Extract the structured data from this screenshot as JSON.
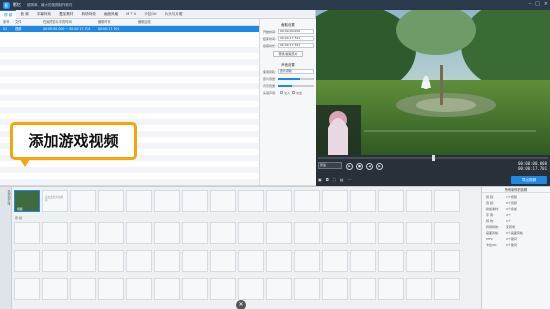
{
  "titlebar": {
    "logo_glyph": "影",
    "app_name": "影忆",
    "slogan": "超简单、最大的视频制作软件"
  },
  "tabs": [
    "视 频",
    "音 频",
    "字幕特效",
    "叠加素材",
    "转场特效",
    "画面风格",
    "M T V",
    "卡拉OK",
    "片头与片尾"
  ],
  "list": {
    "headers": [
      "序号",
      "文件",
      "在最终影片中的时间",
      "截取时长",
      "截取区段"
    ],
    "rows": [
      {
        "idx": "01",
        "file": "视频",
        "time": "00:00:00.000 ~ 00:00:17.701",
        "dur": "00:00:17.701",
        "range": ""
      }
    ]
  },
  "settings": {
    "section1": "截取设置",
    "start_label": "开始时间:",
    "start_value": "00:00:00.000",
    "end_label": "结束时间:",
    "end_value": "00:00:17.701",
    "dur_label": "截取时长:",
    "dur_value": "00:00:17.701",
    "preview_btn": "预览/截取原片",
    "section2": "声音设置",
    "vol_label": "使用音轨:",
    "vol_value": "原片音轨",
    "orig_label": "原片音量:",
    "bg_label": "背景音量:",
    "fade_label": "头尾声音:",
    "fade_in": "淡入",
    "fade_out": "淡出"
  },
  "toolbar": {
    "add_video": "添加视频",
    "delete": "删除",
    "confirm": "确认修改"
  },
  "callout": {
    "text": "添加游戏视频"
  },
  "player": {
    "speed": "原速",
    "time_current": "00:00:00.000",
    "time_total": "00:00:17.701",
    "export": "导出视频",
    "progress_fraction": 0.5
  },
  "timeline": {
    "side_label": "已添加片段",
    "track_label": "音 频",
    "first_clip_label": "视频",
    "placeholder_hint": "双击此处添加视频",
    "props": {
      "title": "所有制作的剪辑",
      "items": [
        {
          "k": "视  频:",
          "v": "1个视频"
        },
        {
          "k": "音  频:",
          "v": "0个音频"
        },
        {
          "k": "叠加素材:",
          "v": "0个叠加"
        },
        {
          "k": "字  幕:",
          "v": "0个"
        },
        {
          "k": "特  效:",
          "v": "0个"
        },
        {
          "k": "转场特效:",
          "v": "无转场"
        },
        {
          "k": "画面风格:",
          "v": "0个画面风格"
        },
        {
          "k": "MTV:",
          "v": "0个歌词"
        },
        {
          "k": "卡拉OK:",
          "v": "0个歌词"
        }
      ]
    }
  },
  "colors": {
    "accent": "#1e88e5",
    "callout_border": "#f5a40c",
    "titlebar": "#2b3a4a"
  }
}
